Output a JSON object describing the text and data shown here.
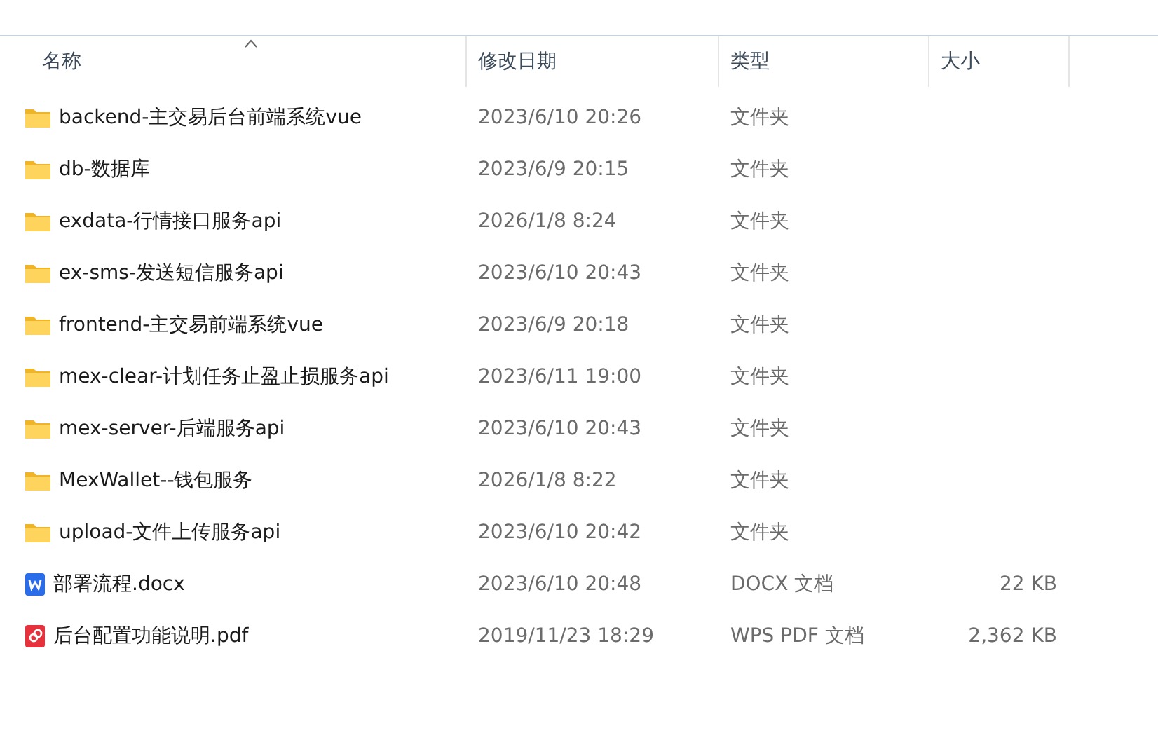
{
  "columns": [
    {
      "label": "名称",
      "sorted": true
    },
    {
      "label": "修改日期",
      "sorted": false
    },
    {
      "label": "类型",
      "sorted": false
    },
    {
      "label": "大小",
      "sorted": false
    }
  ],
  "files": [
    {
      "kind": "folder",
      "name": "backend-主交易后台前端系统vue",
      "modified": "2023/6/10 20:26",
      "type": "文件夹"
    },
    {
      "kind": "folder",
      "name": "db-数据库",
      "modified": "2023/6/9 20:15",
      "type": "文件夹"
    },
    {
      "kind": "folder",
      "name": "exdata-行情接口服务api",
      "modified": "2026/1/8 8:24",
      "type": "文件夹"
    },
    {
      "kind": "folder",
      "name": "ex-sms-发送短信服务api",
      "modified": "2023/6/10 20:43",
      "type": "文件夹"
    },
    {
      "kind": "folder",
      "name": "frontend-主交易前端系统vue",
      "modified": "2023/6/9 20:18",
      "type": "文件夹"
    },
    {
      "kind": "folder",
      "name": "mex-clear-计划任务止盈止损服务api",
      "modified": "2023/6/11 19:00",
      "type": "文件夹"
    },
    {
      "kind": "folder",
      "name": "mex-server-后端服务api",
      "modified": "2023/6/10 20:43",
      "type": "文件夹"
    },
    {
      "kind": "folder",
      "name": "MexWallet--钱包服务",
      "modified": "2026/1/8 8:22",
      "type": "文件夹"
    },
    {
      "kind": "folder",
      "name": "upload-文件上传服务api",
      "modified": "2023/6/10 20:42",
      "type": "文件夹"
    },
    {
      "kind": "docx",
      "name": "部署流程.docx",
      "modified": "2023/6/10 20:48",
      "type": "DOCX 文档",
      "size": "22 KB"
    },
    {
      "kind": "pdf",
      "name": "后台配置功能说明.pdf",
      "modified": "2019/11/23 18:29",
      "type": "WPS PDF 文档",
      "size": "2,362 KB"
    }
  ]
}
